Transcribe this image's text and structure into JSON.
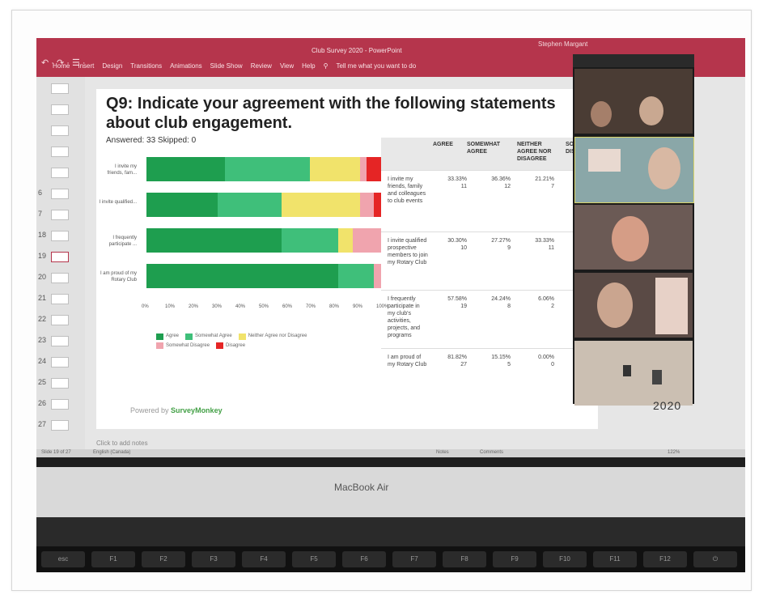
{
  "powerpoint": {
    "title": "Club Survey 2020  -  PowerPoint",
    "user": "Stephen Margant",
    "quick_access": "↶ · ↷ · ☰ ·",
    "tabs": [
      "Home",
      "Insert",
      "Design",
      "Transitions",
      "Animations",
      "Slide Show",
      "Review",
      "View",
      "Help"
    ],
    "tell_me": "Tell me what you want to do",
    "notes_placeholder": "Click to add notes",
    "status_left": "Slide 19 of 27",
    "status_lang": "English (Canada)",
    "status_notes": "Notes",
    "status_comments": "Comments",
    "status_zoom": "122%"
  },
  "thumbnails": [
    "",
    "",
    "",
    "",
    "",
    "6",
    "7",
    "18",
    "19",
    "20",
    "21",
    "22",
    "23",
    "24",
    "25",
    "26",
    "27"
  ],
  "slide": {
    "question": "Q9: Indicate your agreement with the following statements about club engagement.",
    "answered": "Answered: 33    Skipped: 0",
    "powered_by": "Powered by",
    "brand": "SurveyMonkey",
    "year": "2020"
  },
  "chart_data": {
    "type": "bar",
    "orientation": "horizontal-stacked-percent",
    "categories": [
      "I invite my friends, fam...",
      "I invite qualified...",
      "I frequently participate ...",
      "I am proud of my Rotary Club"
    ],
    "series": [
      {
        "name": "Agree",
        "color": "#1e9e4f",
        "values": [
          33.33,
          30.3,
          57.58,
          81.82
        ]
      },
      {
        "name": "Somewhat Agree",
        "color": "#3fbf7a",
        "values": [
          36.36,
          27.27,
          24.24,
          15.15
        ]
      },
      {
        "name": "Neither Agree nor Disagree",
        "color": "#f1e36b",
        "values": [
          21.21,
          33.33,
          6.06,
          0.0
        ]
      },
      {
        "name": "Somewhat Disagree",
        "color": "#f0a4ae",
        "values": [
          3.03,
          6.06,
          12.12,
          3.03
        ]
      },
      {
        "name": "Disagree",
        "color": "#e52525",
        "values": [
          6.06,
          3.03,
          0.0,
          0.0
        ]
      }
    ],
    "ticks": [
      "0%",
      "10%",
      "20%",
      "30%",
      "40%",
      "50%",
      "60%",
      "70%",
      "80%",
      "90%",
      "100%"
    ],
    "xlim": [
      0,
      100
    ]
  },
  "table": {
    "headers": [
      "AGREE",
      "SOMEWHAT AGREE",
      "NEITHER AGREE NOR DISAGREE",
      "SOM DISA"
    ],
    "rows": [
      {
        "statement": "I invite my friends, family and colleagues to club events",
        "agree_pct": "33.33%",
        "agree_n": "11",
        "somewhat_pct": "36.36%",
        "somewhat_n": "12",
        "neither_pct": "21.21%",
        "neither_n": "7"
      },
      {
        "statement": "I invite qualified prospective members to join my Rotary Club",
        "agree_pct": "30.30%",
        "agree_n": "10",
        "somewhat_pct": "27.27%",
        "somewhat_n": "9",
        "neither_pct": "33.33%",
        "neither_n": "11"
      },
      {
        "statement": "I frequently participate in my club's activities, projects, and programs",
        "agree_pct": "57.58%",
        "agree_n": "19",
        "somewhat_pct": "24.24%",
        "somewhat_n": "8",
        "neither_pct": "6.06%",
        "neither_n": "2"
      },
      {
        "statement": "I am proud of my Rotary Club",
        "agree_pct": "81.82%",
        "agree_n": "27",
        "somewhat_pct": "15.15%",
        "somewhat_n": "5",
        "neither_pct": "0.00%",
        "neither_n": "0"
      }
    ]
  },
  "laptop": {
    "brand": "MacBook Air",
    "keys": [
      "esc",
      "F1",
      "F2",
      "F3",
      "F4",
      "F5",
      "F6",
      "F7",
      "F8",
      "F9",
      "F10",
      "F11",
      "F12",
      "⏻"
    ]
  },
  "colors": {
    "ppt_red": "#b5354c",
    "agree": "#1e9e4f",
    "somewhat_agree": "#3fbf7a",
    "neither": "#f1e36b",
    "somewhat_disagree": "#f0a4ae",
    "disagree": "#e52525"
  }
}
